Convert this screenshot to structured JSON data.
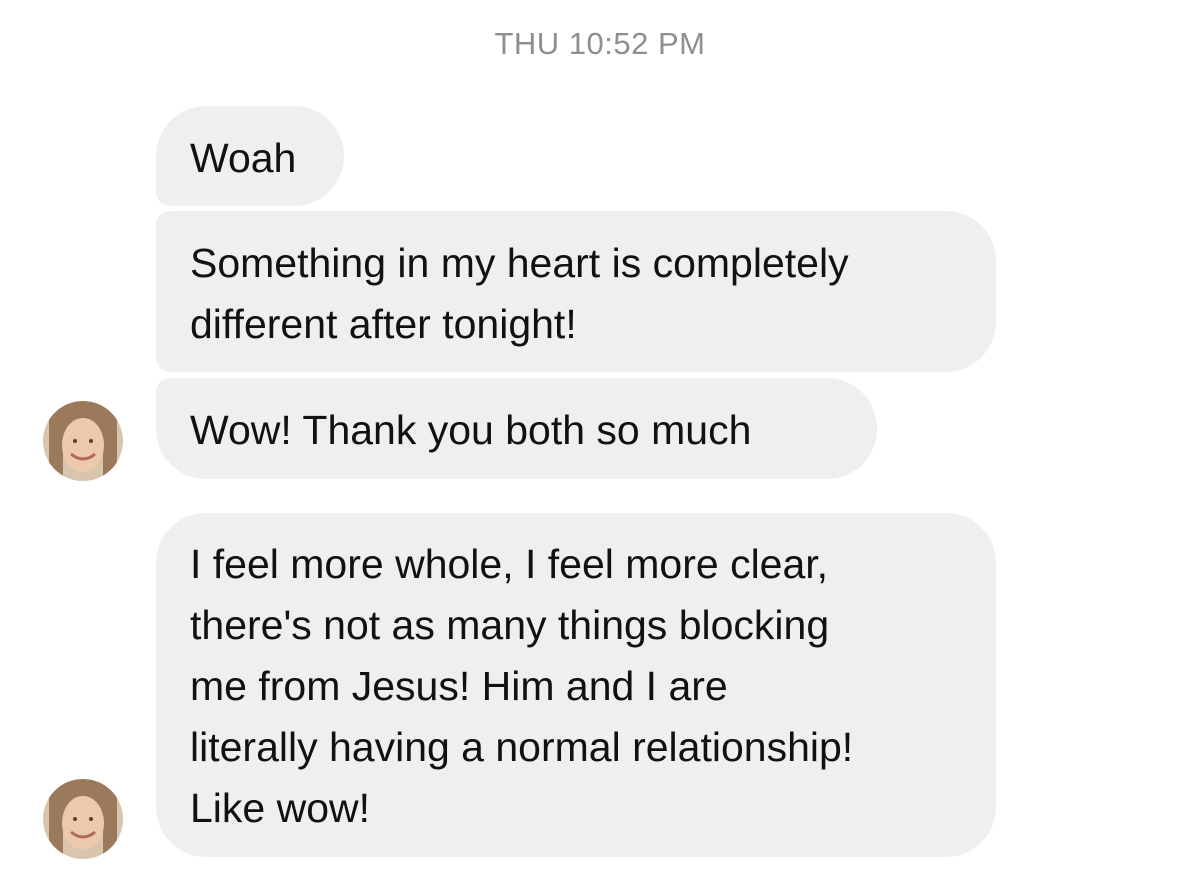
{
  "thread": {
    "timestamp": "THU 10:52 PM"
  },
  "messages": [
    {
      "text": "Woah"
    },
    {
      "text": "Something in my heart is completely\ndifferent after tonight!"
    },
    {
      "text": "Wow! Thank you both so much"
    },
    {
      "text": "I feel more whole, I feel more clear,\nthere's not as many things blocking\nme from Jesus! Him and I are\nliterally having a normal relationship!\nLike wow!"
    }
  ],
  "colors": {
    "incoming_bubble": "#efefef",
    "timestamp_text": "#8e8e93",
    "message_text": "#111111"
  },
  "icons": {
    "sender_avatar": "sender-avatar-photo"
  }
}
